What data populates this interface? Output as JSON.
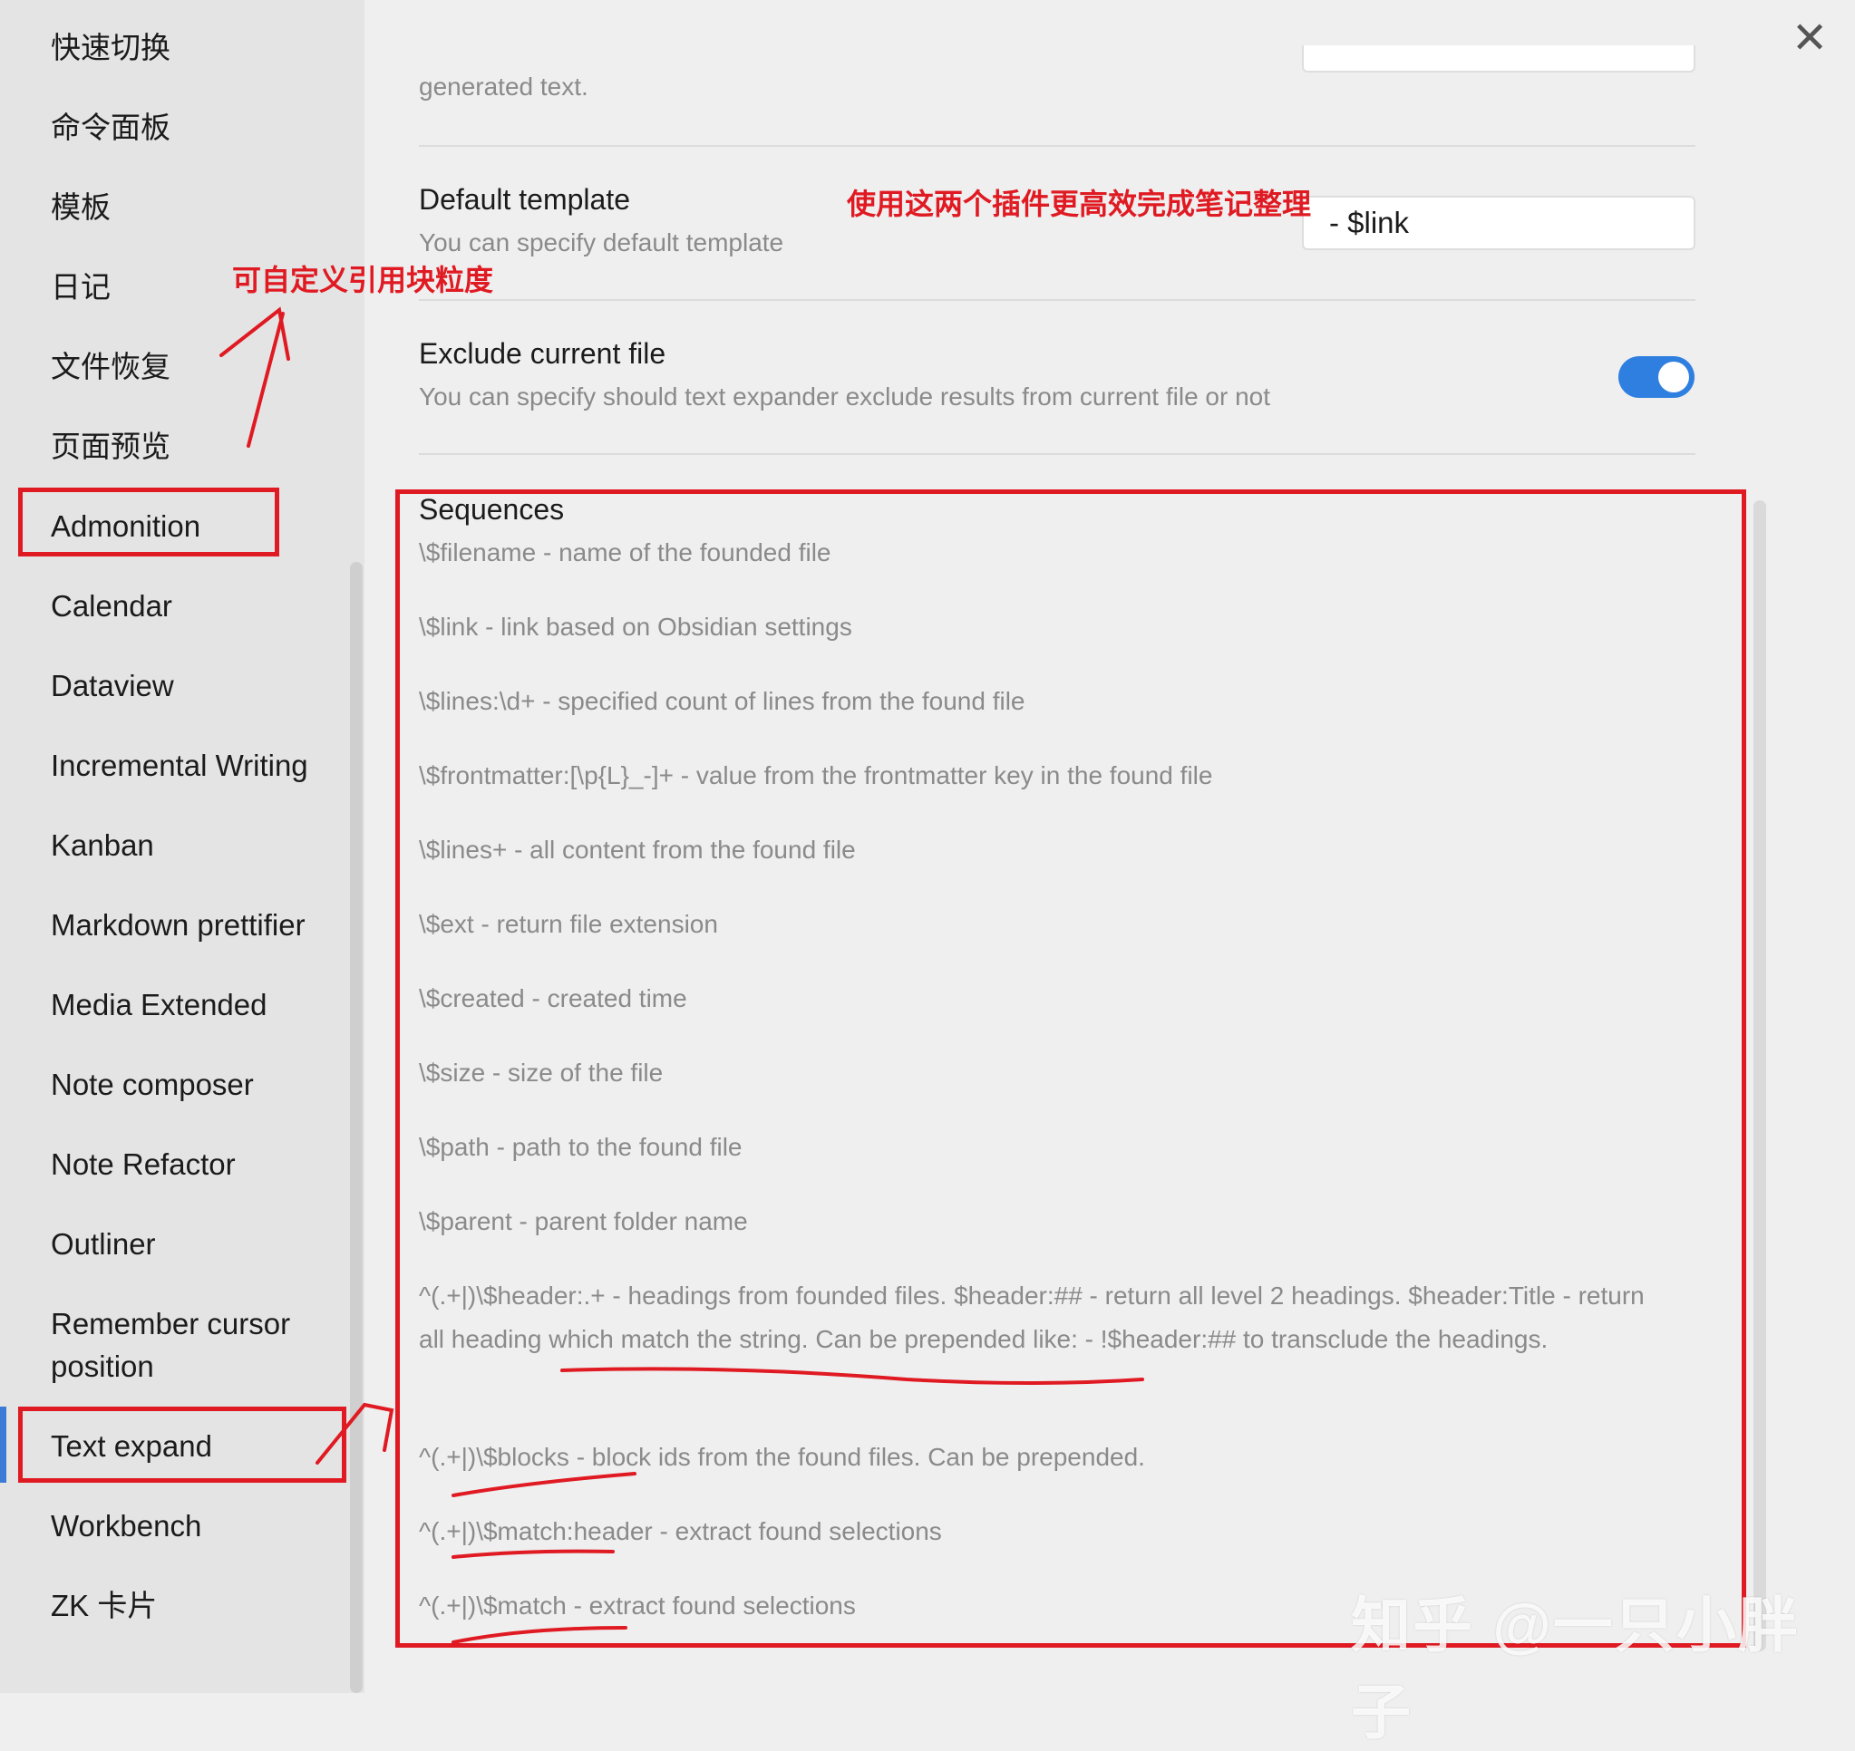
{
  "sidebar": {
    "items": [
      {
        "label": "快速切换"
      },
      {
        "label": "命令面板"
      },
      {
        "label": "模板"
      },
      {
        "label": "日记"
      },
      {
        "label": "文件恢复"
      },
      {
        "label": "页面预览"
      },
      {
        "label": "Admonition"
      },
      {
        "label": "Calendar"
      },
      {
        "label": "Dataview"
      },
      {
        "label": "Incremental Writing"
      },
      {
        "label": "Kanban"
      },
      {
        "label": "Markdown prettifier"
      },
      {
        "label": "Media Extended"
      },
      {
        "label": "Note composer"
      },
      {
        "label": "Note Refactor"
      },
      {
        "label": "Outliner"
      },
      {
        "label": "Remember cursor"
      },
      {
        "label": "position"
      },
      {
        "label": "Text expand"
      },
      {
        "label": "Workbench"
      },
      {
        "label": "ZK 卡片"
      }
    ]
  },
  "settings": {
    "top_desc": "generated text.",
    "default_template": {
      "title": "Default template",
      "desc": "You can specify default template",
      "value": "- $link"
    },
    "exclude_current_file": {
      "title": "Exclude current file",
      "desc": "You can specify should text expander exclude results from current file or not",
      "enabled": true
    },
    "sequences": {
      "title": "Sequences",
      "items": [
        "\\$filename - name of the founded file",
        "\\$link - link based on Obsidian settings",
        "\\$lines:\\d+ - specified count of lines from the found file",
        "\\$frontmatter:[\\p{L}_-]+ - value from the frontmatter key in the found file",
        "\\$lines+ - all content from the found file",
        "\\$ext - return file extension",
        "\\$created - created time",
        "\\$size - size of the file",
        "\\$path - path to the found file",
        "\\$parent - parent folder name",
        "^(.+|)\\$header:.+ - headings from founded files. $header:## - return all level 2 headings. $header:Title - return all heading which match the string. Can be prepended like: - !$header:## to transclude the headings.",
        "^(.+|)\\$blocks - block ids from the found files. Can be prepended.",
        "^(.+|)\\$match:header - extract found selections",
        "^(.+|)\\$match - extract found selections"
      ]
    }
  },
  "annotations": {
    "top": "使用这两个插件更高效完成笔记整理",
    "left": "可自定义引用块粒度",
    "watermark": "知乎 @一只小胖子"
  },
  "colors": {
    "accent": "#2f7fe0",
    "annotation_red": "#e01a22"
  },
  "icons": {
    "close": "close-icon"
  }
}
